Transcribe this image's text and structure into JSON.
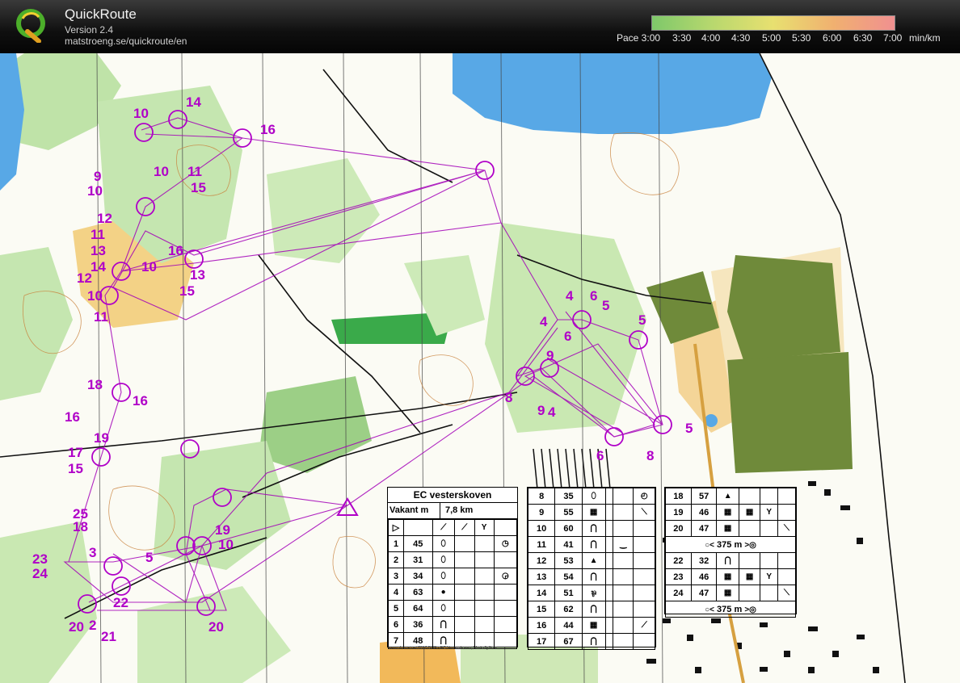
{
  "app": {
    "name": "QuickRoute",
    "version": "Version 2.4",
    "url": "matstroeng.se/quickroute/en"
  },
  "pace_legend": {
    "labels": [
      "Pace 3:00",
      "3:30",
      "4:00",
      "4:30",
      "5:00",
      "5:30",
      "6:00",
      "6:30",
      "7:00",
      "min/km"
    ],
    "colors": [
      "#7ec86a",
      "#b8d86e",
      "#e8e070",
      "#f0b070",
      "#f09090"
    ]
  },
  "course_card": {
    "title": "EC vesterskoven",
    "class": "Vakant m",
    "length": "7,8 km",
    "controls_a": [
      {
        "n": "1",
        "code": "45"
      },
      {
        "n": "2",
        "code": "31"
      },
      {
        "n": "3",
        "code": "34"
      },
      {
        "n": "4",
        "code": "63"
      },
      {
        "n": "5",
        "code": "64"
      },
      {
        "n": "6",
        "code": "36"
      },
      {
        "n": "7",
        "code": "48"
      }
    ],
    "controls_b": [
      {
        "n": "8",
        "code": "35"
      },
      {
        "n": "9",
        "code": "55"
      },
      {
        "n": "10",
        "code": "60"
      },
      {
        "n": "11",
        "code": "41"
      },
      {
        "n": "12",
        "code": "53"
      },
      {
        "n": "13",
        "code": "54"
      },
      {
        "n": "14",
        "code": "51"
      },
      {
        "n": "15",
        "code": "62"
      },
      {
        "n": "16",
        "code": "44"
      },
      {
        "n": "17",
        "code": "67"
      }
    ],
    "controls_c": [
      {
        "n": "18",
        "code": "57"
      },
      {
        "n": "19",
        "code": "46"
      },
      {
        "n": "20",
        "code": "47"
      }
    ],
    "marked_route_1": "375 m",
    "controls_d": [
      {
        "n": "22",
        "code": "32"
      },
      {
        "n": "23",
        "code": "46"
      },
      {
        "n": "24",
        "code": "47"
      }
    ],
    "marked_route_2": "375 m",
    "copyright": "www.oframe.net 2017 DOF - EC Vesterskoven, Marksflyfilme"
  },
  "map_control_labels": [
    "14",
    "10",
    "16",
    "10",
    "9",
    "11",
    "15",
    "10",
    "12",
    "11",
    "13",
    "14",
    "16",
    "10",
    "12",
    "10",
    "15",
    "13",
    "11",
    "18",
    "16",
    "16",
    "19",
    "17",
    "15",
    "25",
    "18",
    "23",
    "24",
    "3",
    "5",
    "2",
    "20",
    "21",
    "20",
    "22",
    "19",
    "10",
    "4",
    "6",
    "5",
    "4",
    "6",
    "5",
    "9",
    "8",
    "9",
    "4",
    "6",
    "8",
    "5"
  ],
  "colors": {
    "route": "#a300b8",
    "control": "#b000c8",
    "water": "#58a8e6",
    "forest_green": "#8ec86e",
    "dark_green": "#3aaa4a",
    "open_land": "#f5c870",
    "settlement": "#6f8a3a"
  }
}
